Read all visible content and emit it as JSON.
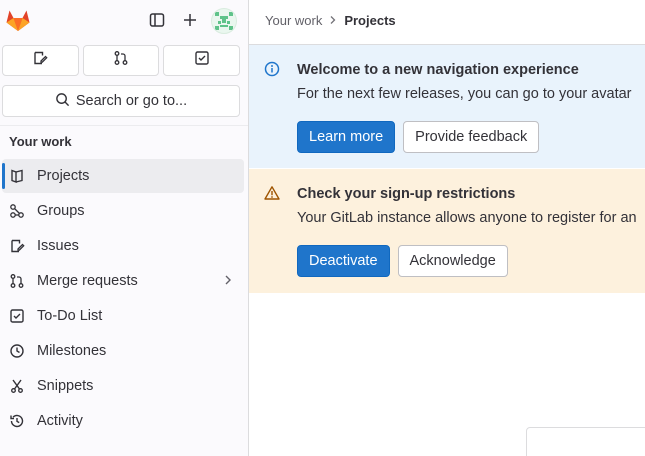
{
  "sidebar": {
    "search_label": "Search or go to...",
    "section_title": "Your work",
    "items": [
      {
        "label": "Projects",
        "icon": "project-icon",
        "active": true
      },
      {
        "label": "Groups",
        "icon": "group-icon"
      },
      {
        "label": "Issues",
        "icon": "issues-icon"
      },
      {
        "label": "Merge requests",
        "icon": "merge-request-icon",
        "has_submenu": true
      },
      {
        "label": "To-Do List",
        "icon": "todo-icon"
      },
      {
        "label": "Milestones",
        "icon": "milestone-icon"
      },
      {
        "label": "Snippets",
        "icon": "snippet-icon"
      },
      {
        "label": "Activity",
        "icon": "history-icon"
      }
    ]
  },
  "breadcrumb": {
    "parent": "Your work",
    "current": "Projects"
  },
  "alerts": {
    "navigation": {
      "title": "Welcome to a new navigation experience",
      "body": "For the next few releases, you can go to your avatar",
      "primary": "Learn more",
      "secondary": "Provide feedback"
    },
    "signup": {
      "title": "Check your sign-up restrictions",
      "body": "Your GitLab instance allows anyone to register for an",
      "primary": "Deactivate",
      "secondary": "Acknowledge"
    }
  },
  "colors": {
    "accent": "#1f75cb",
    "info_bg": "#e9f3fc",
    "warning_bg": "#fdf1dd",
    "logo_orange": "#fc6d26"
  }
}
